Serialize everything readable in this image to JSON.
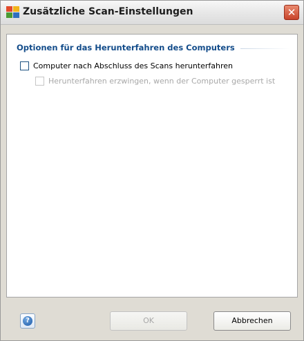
{
  "window": {
    "title": "Zusätzliche Scan-Einstellungen",
    "icon": "avg-logo-icon",
    "close_icon": "close-icon"
  },
  "section": {
    "header": "Optionen für das Herunterfahren des Computers"
  },
  "options": [
    {
      "label": "Computer nach Abschluss des Scans herunterfahren",
      "checked": false,
      "enabled": true
    },
    {
      "label": "Herunterfahren erzwingen, wenn der Computer gesperrt ist",
      "checked": false,
      "enabled": false
    }
  ],
  "footer": {
    "help_icon": "help-icon",
    "ok_label": "OK",
    "cancel_label": "Abbrechen"
  },
  "colors": {
    "section_header": "#134c8a",
    "close_button": "#c8432a"
  }
}
